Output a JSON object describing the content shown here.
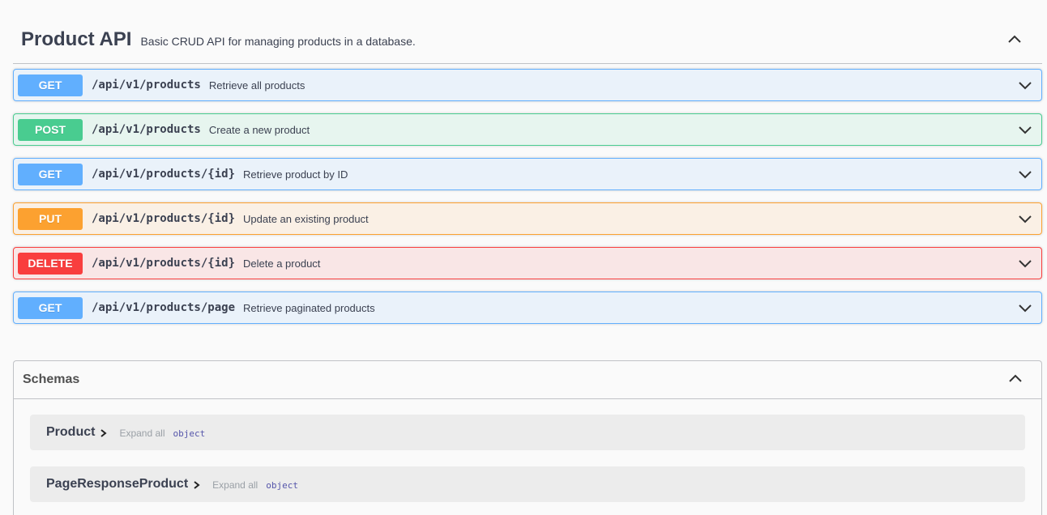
{
  "tag": {
    "title": "Product API",
    "description": "Basic CRUD API for managing products in a database."
  },
  "operations": [
    {
      "method": "GET",
      "path": "/api/v1/products",
      "summary": "Retrieve all products"
    },
    {
      "method": "POST",
      "path": "/api/v1/products",
      "summary": "Create a new product"
    },
    {
      "method": "GET",
      "path": "/api/v1/products/{id}",
      "summary": "Retrieve product by ID"
    },
    {
      "method": "PUT",
      "path": "/api/v1/products/{id}",
      "summary": "Update an existing product"
    },
    {
      "method": "DELETE",
      "path": "/api/v1/products/{id}",
      "summary": "Delete a product"
    },
    {
      "method": "GET",
      "path": "/api/v1/products/page",
      "summary": "Retrieve paginated products"
    }
  ],
  "schemas": {
    "title": "Schemas",
    "models": [
      {
        "name": "Product",
        "expand_label": "Expand all",
        "type": "object"
      },
      {
        "name": "PageResponseProduct",
        "expand_label": "Expand all",
        "type": "object"
      }
    ]
  },
  "colors": {
    "get": "#61affe",
    "post": "#49cc90",
    "put": "#fca130",
    "delete": "#f93e3e"
  },
  "icons": {
    "tag_toggle": "chevron-up-icon",
    "operation_toggle": "chevron-down-icon",
    "model_arrow": "chevron-right-icon"
  }
}
